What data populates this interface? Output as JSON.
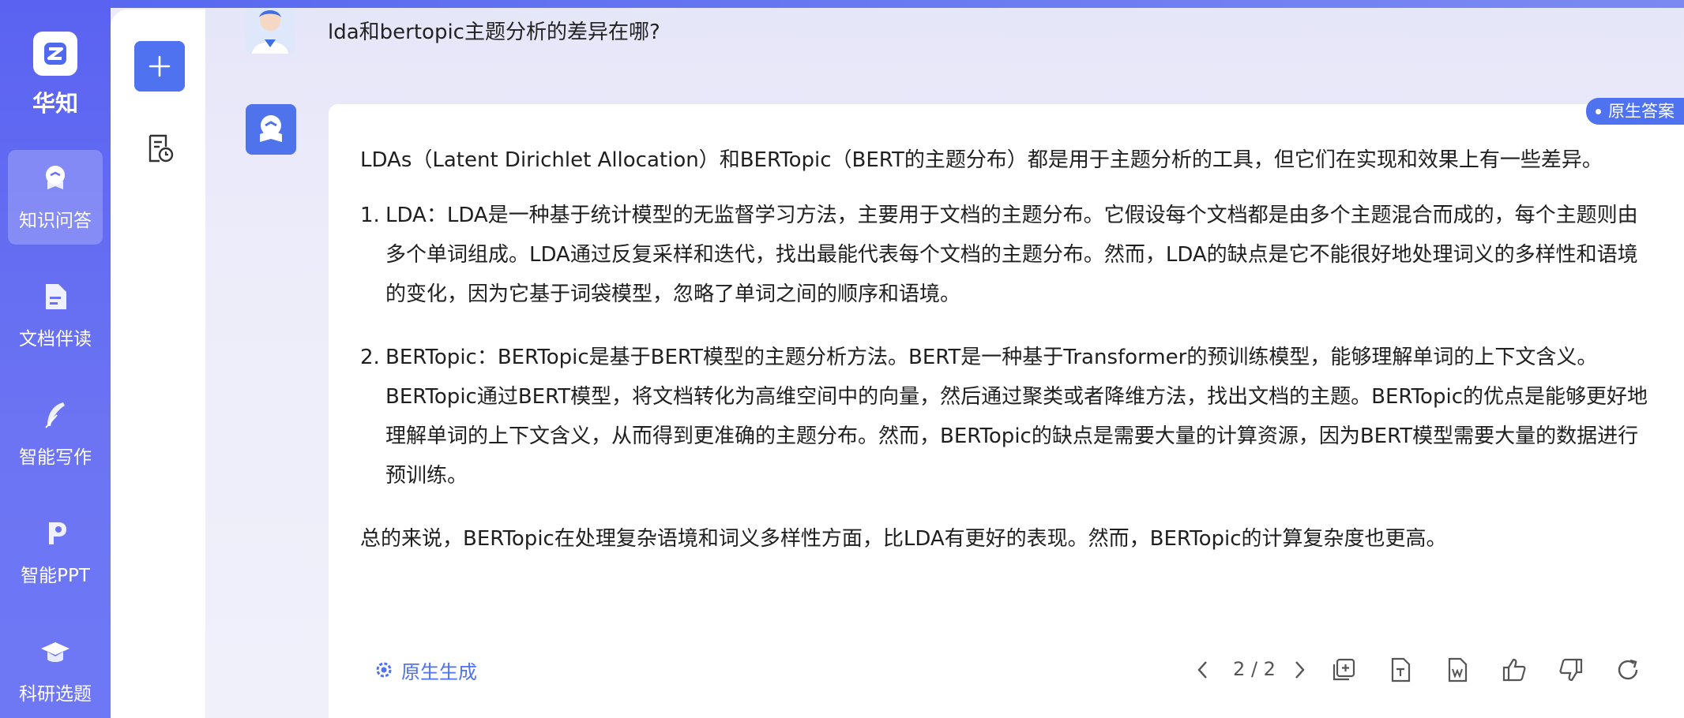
{
  "sidebar": {
    "brand": "华知",
    "items": [
      {
        "label": "知识问答",
        "icon": "chat-book-icon",
        "active": true
      },
      {
        "label": "文档伴读",
        "icon": "document-icon",
        "active": false
      },
      {
        "label": "智能写作",
        "icon": "feather-pen-icon",
        "active": false
      },
      {
        "label": "智能PPT",
        "icon": "ppt-icon",
        "active": false
      },
      {
        "label": "科研选题",
        "icon": "graduation-cap-icon",
        "active": false
      }
    ]
  },
  "subcol": {
    "new_icon": "plus-icon",
    "history_icon": "history-icon"
  },
  "chat": {
    "question": "lda和bertopic主题分析的差异在哪?",
    "badge": "原生答案",
    "answer": {
      "intro": "LDAs（Latent Dirichlet Allocation）和BERTopic（BERT的主题分布）都是用于主题分析的工具，但它们在实现和效果上有一些差异。",
      "items": [
        {
          "num": "1.",
          "text": "LDA：LDA是一种基于统计模型的无监督学习方法，主要用于文档的主题分布。它假设每个文档都是由多个主题混合而成的，每个主题则由多个单词组成。LDA通过反复采样和迭代，找出最能代表每个文档的主题分布。然而，LDA的缺点是它不能很好地处理词义的多样性和语境的变化，因为它基于词袋模型，忽略了单词之间的顺序和语境。"
        },
        {
          "num": "2.",
          "text": "BERTopic：BERTopic是基于BERT模型的主题分析方法。BERT是一种基于Transformer的预训练模型，能够理解单词的上下文含义。BERTopic通过BERT模型，将文档转化为高维空间中的向量，然后通过聚类或者降维方法，找出文档的主题。BERTopic的优点是能够更好地理解单词的上下文含义，从而得到更准确的主题分布。然而，BERTopic的缺点是需要大量的计算资源，因为BERT模型需要大量的数据进行预训练。"
        }
      ],
      "conclusion": "总的来说，BERTopic在处理复杂语境和词义多样性方面，比LDA有更好的表现。然而，BERTopic的计算复杂度也更高。"
    },
    "footer": {
      "generate_label": "原生生成",
      "pager": "2 / 2"
    }
  },
  "colors": {
    "accent": "#4f72f0",
    "rail": "#5a63f1"
  }
}
